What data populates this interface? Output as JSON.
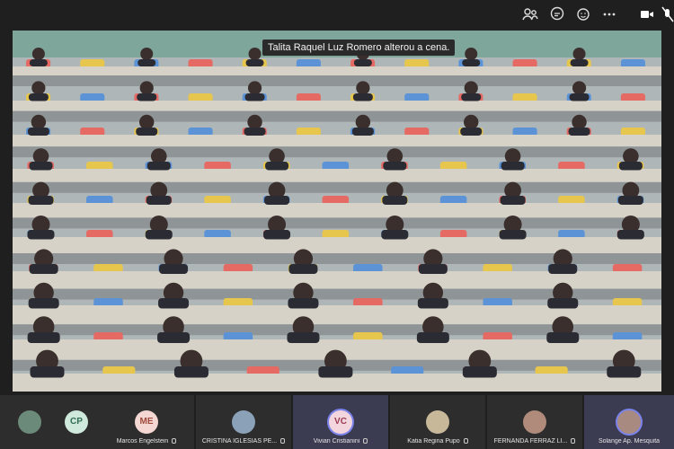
{
  "toolbar": {
    "icons": [
      "people-icon",
      "chat-icon",
      "reactions-icon",
      "more-icon",
      "camera-icon",
      "mic-off-icon"
    ]
  },
  "stage": {
    "toast": "Talita Raquel Luz Romero alterou a cena."
  },
  "thumbnails": [
    {
      "initials": "",
      "name": "",
      "photo": true
    },
    {
      "initials": "CP",
      "name": "",
      "photo": false
    },
    {
      "initials": "ME",
      "name": "Marcos Engelstein",
      "photo": false
    },
    {
      "initials": "",
      "name": "CRISTINA IGLESIAS PE...",
      "photo": true
    },
    {
      "initials": "VC",
      "name": "Vivian Cristianini",
      "photo": false
    },
    {
      "initials": "",
      "name": "Katia Regina Pupo",
      "photo": true
    },
    {
      "initials": "",
      "name": "FERNANDA FERRAZ LI...",
      "photo": true
    },
    {
      "initials": "",
      "name": "Solange Ap. Mesquita",
      "photo": true
    }
  ],
  "colors": {
    "wall": "#7fa69a",
    "desk": "#d7d2c8",
    "chair_colors": [
      "#e56a64",
      "#e7c64d",
      "#5b93d6"
    ],
    "accent": "#7b83eb"
  }
}
